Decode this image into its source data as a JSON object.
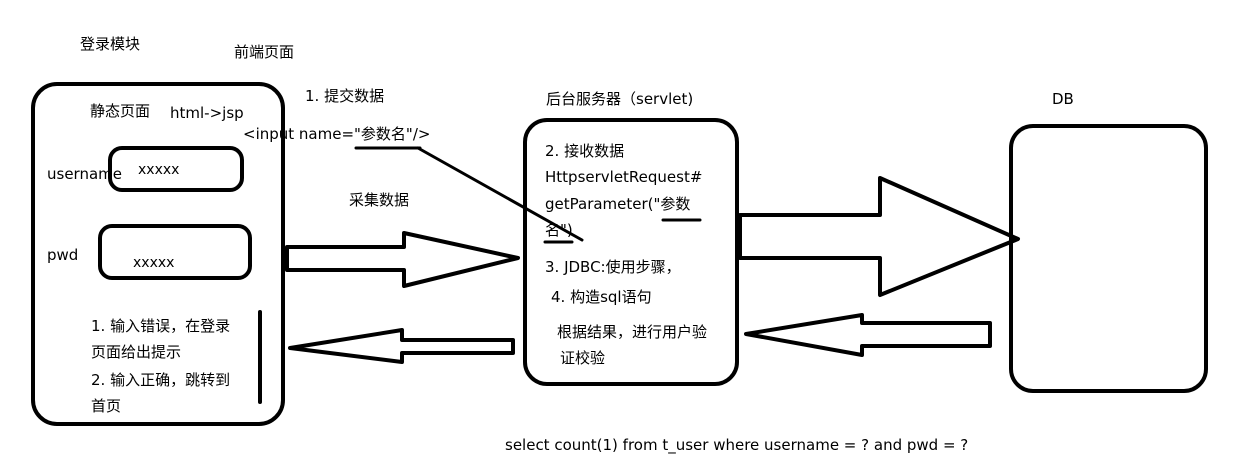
{
  "labels": {
    "login_module": "登录模块",
    "frontend_page": "前端页面",
    "static_page": "静态页面",
    "html_jsp": "html->jsp",
    "username_label": "username",
    "username_value": "xxxxx",
    "pwd_label": "pwd",
    "pwd_value": "xxxxx",
    "hint_line1": "1. 输入错误，在登录",
    "hint_line2": "页面给出提示",
    "hint_line3": "2. 输入正确，跳转到",
    "hint_line4": "首页",
    "submit_data": "1. 提交数据",
    "input_tag": "<input name=\"参数名\"/>",
    "collect_data": "采集数据",
    "backend_server": "后台服务器（servlet)",
    "step2": "2. 接收数据",
    "request_line1": "HttpservletRequest#",
    "request_line2": "getParameter(\"参数",
    "request_line3": "名\")",
    "step3": "3. JDBC:使用步骤，",
    "step4": "4. 构造sql语句",
    "verify_line1": "根据结果，进行用户验",
    "verify_line2": "证校验",
    "db": "DB",
    "sql": "select count(1) from t_user where username = ? and pwd = ?"
  }
}
